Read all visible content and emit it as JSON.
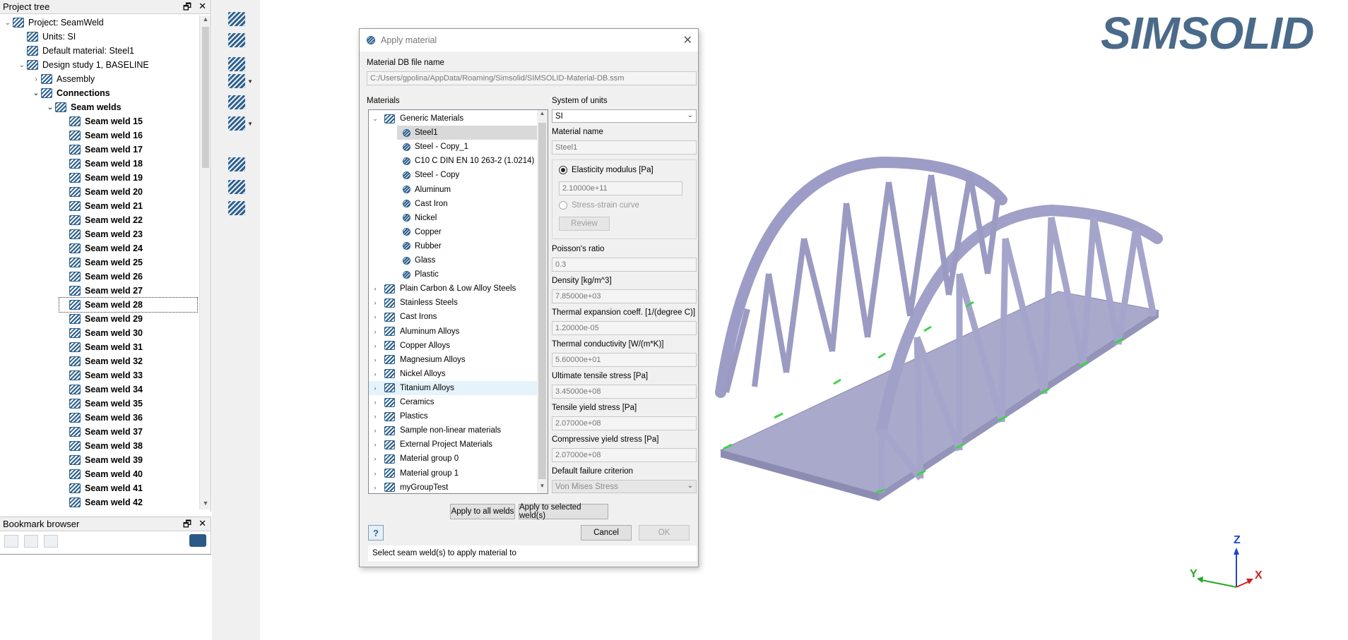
{
  "project_tree": {
    "title": "Project tree",
    "items": [
      {
        "label": "Project: SeamWeld",
        "indent": 0,
        "chev": "v",
        "icon": "simsolid-icon",
        "bold": false
      },
      {
        "label": "Units: SI",
        "indent": 1,
        "chev": "",
        "icon": "ruler-icon",
        "bold": false
      },
      {
        "label": "Default material: Steel1",
        "indent": 1,
        "chev": "",
        "icon": "material-icon",
        "bold": false
      },
      {
        "label": "Design study 1, BASELINE",
        "indent": 1,
        "chev": "v",
        "icon": "design-study-icon",
        "bold": false
      },
      {
        "label": "Assembly",
        "indent": 2,
        "chev": ">",
        "icon": "assembly-icon",
        "bold": false
      },
      {
        "label": "Connections",
        "indent": 2,
        "chev": "v",
        "icon": "connections-icon",
        "bold": true
      },
      {
        "label": "Seam welds",
        "indent": 3,
        "chev": "v",
        "icon": "seam-weld-icon",
        "bold": true
      },
      {
        "label": "Seam weld 15",
        "indent": 4,
        "chev": "",
        "icon": "seam-weld-icon",
        "bold": true
      },
      {
        "label": "Seam weld 16",
        "indent": 4,
        "chev": "",
        "icon": "seam-weld-icon",
        "bold": true
      },
      {
        "label": "Seam weld 17",
        "indent": 4,
        "chev": "",
        "icon": "seam-weld-icon",
        "bold": true
      },
      {
        "label": "Seam weld 18",
        "indent": 4,
        "chev": "",
        "icon": "seam-weld-icon",
        "bold": true
      },
      {
        "label": "Seam weld 19",
        "indent": 4,
        "chev": "",
        "icon": "seam-weld-icon",
        "bold": true
      },
      {
        "label": "Seam weld 20",
        "indent": 4,
        "chev": "",
        "icon": "seam-weld-icon",
        "bold": true
      },
      {
        "label": "Seam weld 21",
        "indent": 4,
        "chev": "",
        "icon": "seam-weld-icon",
        "bold": true
      },
      {
        "label": "Seam weld 22",
        "indent": 4,
        "chev": "",
        "icon": "seam-weld-icon",
        "bold": true
      },
      {
        "label": "Seam weld 23",
        "indent": 4,
        "chev": "",
        "icon": "seam-weld-icon",
        "bold": true
      },
      {
        "label": "Seam weld 24",
        "indent": 4,
        "chev": "",
        "icon": "seam-weld-icon",
        "bold": true
      },
      {
        "label": "Seam weld 25",
        "indent": 4,
        "chev": "",
        "icon": "seam-weld-icon",
        "bold": true
      },
      {
        "label": "Seam weld 26",
        "indent": 4,
        "chev": "",
        "icon": "seam-weld-icon",
        "bold": true
      },
      {
        "label": "Seam weld 27",
        "indent": 4,
        "chev": "",
        "icon": "seam-weld-icon",
        "bold": true
      },
      {
        "label": "Seam weld 28",
        "indent": 4,
        "chev": "",
        "icon": "seam-weld-icon",
        "bold": true,
        "selected": true
      },
      {
        "label": "Seam weld 29",
        "indent": 4,
        "chev": "",
        "icon": "seam-weld-icon",
        "bold": true
      },
      {
        "label": "Seam weld 30",
        "indent": 4,
        "chev": "",
        "icon": "seam-weld-icon",
        "bold": true
      },
      {
        "label": "Seam weld 31",
        "indent": 4,
        "chev": "",
        "icon": "seam-weld-icon",
        "bold": true
      },
      {
        "label": "Seam weld 32",
        "indent": 4,
        "chev": "",
        "icon": "seam-weld-icon",
        "bold": true
      },
      {
        "label": "Seam weld 33",
        "indent": 4,
        "chev": "",
        "icon": "seam-weld-icon",
        "bold": true
      },
      {
        "label": "Seam weld 34",
        "indent": 4,
        "chev": "",
        "icon": "seam-weld-icon",
        "bold": true
      },
      {
        "label": "Seam weld 35",
        "indent": 4,
        "chev": "",
        "icon": "seam-weld-icon",
        "bold": true
      },
      {
        "label": "Seam weld 36",
        "indent": 4,
        "chev": "",
        "icon": "seam-weld-icon",
        "bold": true
      },
      {
        "label": "Seam weld 37",
        "indent": 4,
        "chev": "",
        "icon": "seam-weld-icon",
        "bold": true
      },
      {
        "label": "Seam weld 38",
        "indent": 4,
        "chev": "",
        "icon": "seam-weld-icon",
        "bold": true
      },
      {
        "label": "Seam weld 39",
        "indent": 4,
        "chev": "",
        "icon": "seam-weld-icon",
        "bold": true
      },
      {
        "label": "Seam weld 40",
        "indent": 4,
        "chev": "",
        "icon": "seam-weld-icon",
        "bold": true
      },
      {
        "label": "Seam weld 41",
        "indent": 4,
        "chev": "",
        "icon": "seam-weld-icon",
        "bold": true
      },
      {
        "label": "Seam weld 42",
        "indent": 4,
        "chev": "",
        "icon": "seam-weld-icon",
        "bold": true
      }
    ]
  },
  "bookmark_browser": {
    "title": "Bookmark browser"
  },
  "panel_buttons": {
    "float": "🗗",
    "close": "✕"
  },
  "logo": {
    "text": "SIMSOLID"
  },
  "dialog": {
    "title": "Apply material",
    "db_label": "Material DB file name",
    "db_path": "C:/Users/gpolina/AppData/Roaming/Simsolid/SIMSOLID-Material-DB.ssm",
    "materials_label": "Materials",
    "materials": [
      {
        "type": "group",
        "label": "Generic Materials",
        "expanded": true
      },
      {
        "type": "item",
        "label": "Steel1",
        "selected": true
      },
      {
        "type": "item",
        "label": "Steel - Copy_1"
      },
      {
        "type": "item",
        "label": "C10 C DIN EN 10 263-2 (1.0214)"
      },
      {
        "type": "item",
        "label": "Steel - Copy"
      },
      {
        "type": "item",
        "label": "Aluminum"
      },
      {
        "type": "item",
        "label": "Cast Iron"
      },
      {
        "type": "item",
        "label": "Nickel"
      },
      {
        "type": "item",
        "label": "Copper"
      },
      {
        "type": "item",
        "label": "Rubber"
      },
      {
        "type": "item",
        "label": "Glass"
      },
      {
        "type": "item",
        "label": "Plastic"
      },
      {
        "type": "group",
        "label": "Plain Carbon & Low Alloy Steels"
      },
      {
        "type": "group",
        "label": "Stainless Steels"
      },
      {
        "type": "group",
        "label": "Cast Irons"
      },
      {
        "type": "group",
        "label": "Aluminum Alloys"
      },
      {
        "type": "group",
        "label": "Copper Alloys"
      },
      {
        "type": "group",
        "label": "Magnesium Alloys"
      },
      {
        "type": "group",
        "label": "Nickel Alloys"
      },
      {
        "type": "group",
        "label": "Titanium Alloys",
        "hover": true
      },
      {
        "type": "group",
        "label": "Ceramics"
      },
      {
        "type": "group",
        "label": "Plastics"
      },
      {
        "type": "group",
        "label": "Sample non-linear materials"
      },
      {
        "type": "group",
        "label": "External Project Materials"
      },
      {
        "type": "group",
        "label": "Material group 0"
      },
      {
        "type": "group",
        "label": "Material group 1"
      },
      {
        "type": "group",
        "label": "myGroupTest"
      }
    ],
    "units_label": "System of units",
    "units_value": "SI",
    "material_name_label": "Material name",
    "material_name": "Steel1",
    "elasticity_label": "Elasticity modulus [Pa]",
    "elasticity_value": "2.10000e+11",
    "stress_strain_label": "Stress-strain curve",
    "review_label": "Review",
    "poisson_label": "Poisson's ratio",
    "poisson_value": "0.3",
    "density_label": "Density [kg/m^3]",
    "density_value": "7.85000e+03",
    "thermal_exp_label": "Thermal expansion coeff. [1/(degree C)]",
    "thermal_exp_value": "1.20000e-05",
    "thermal_cond_label": "Thermal conductivity [W/(m*K)]",
    "thermal_cond_value": "5.60000e+01",
    "uts_label": "Ultimate tensile stress [Pa]",
    "uts_value": "3.45000e+08",
    "tys_label": "Tensile yield stress [Pa]",
    "tys_value": "2.07000e+08",
    "cys_label": "Compressive yield stress [Pa]",
    "cys_value": "2.07000e+08",
    "failure_label": "Default failure criterion",
    "failure_value": "Von Mises Stress",
    "apply_all_label": "Apply to all welds",
    "apply_selected_label": "Apply to selected weld(s)",
    "help_label": "?",
    "cancel_label": "Cancel",
    "ok_label": "OK",
    "status_text": "Select seam weld(s) to apply material to"
  },
  "triad": {
    "z": "Z",
    "y": "Y",
    "x": "X"
  },
  "colors": {
    "accent": "#2b5f8c",
    "bridge": "#a3a3c8",
    "weld": "#3fd24a",
    "logo": "#4a6a8a"
  }
}
